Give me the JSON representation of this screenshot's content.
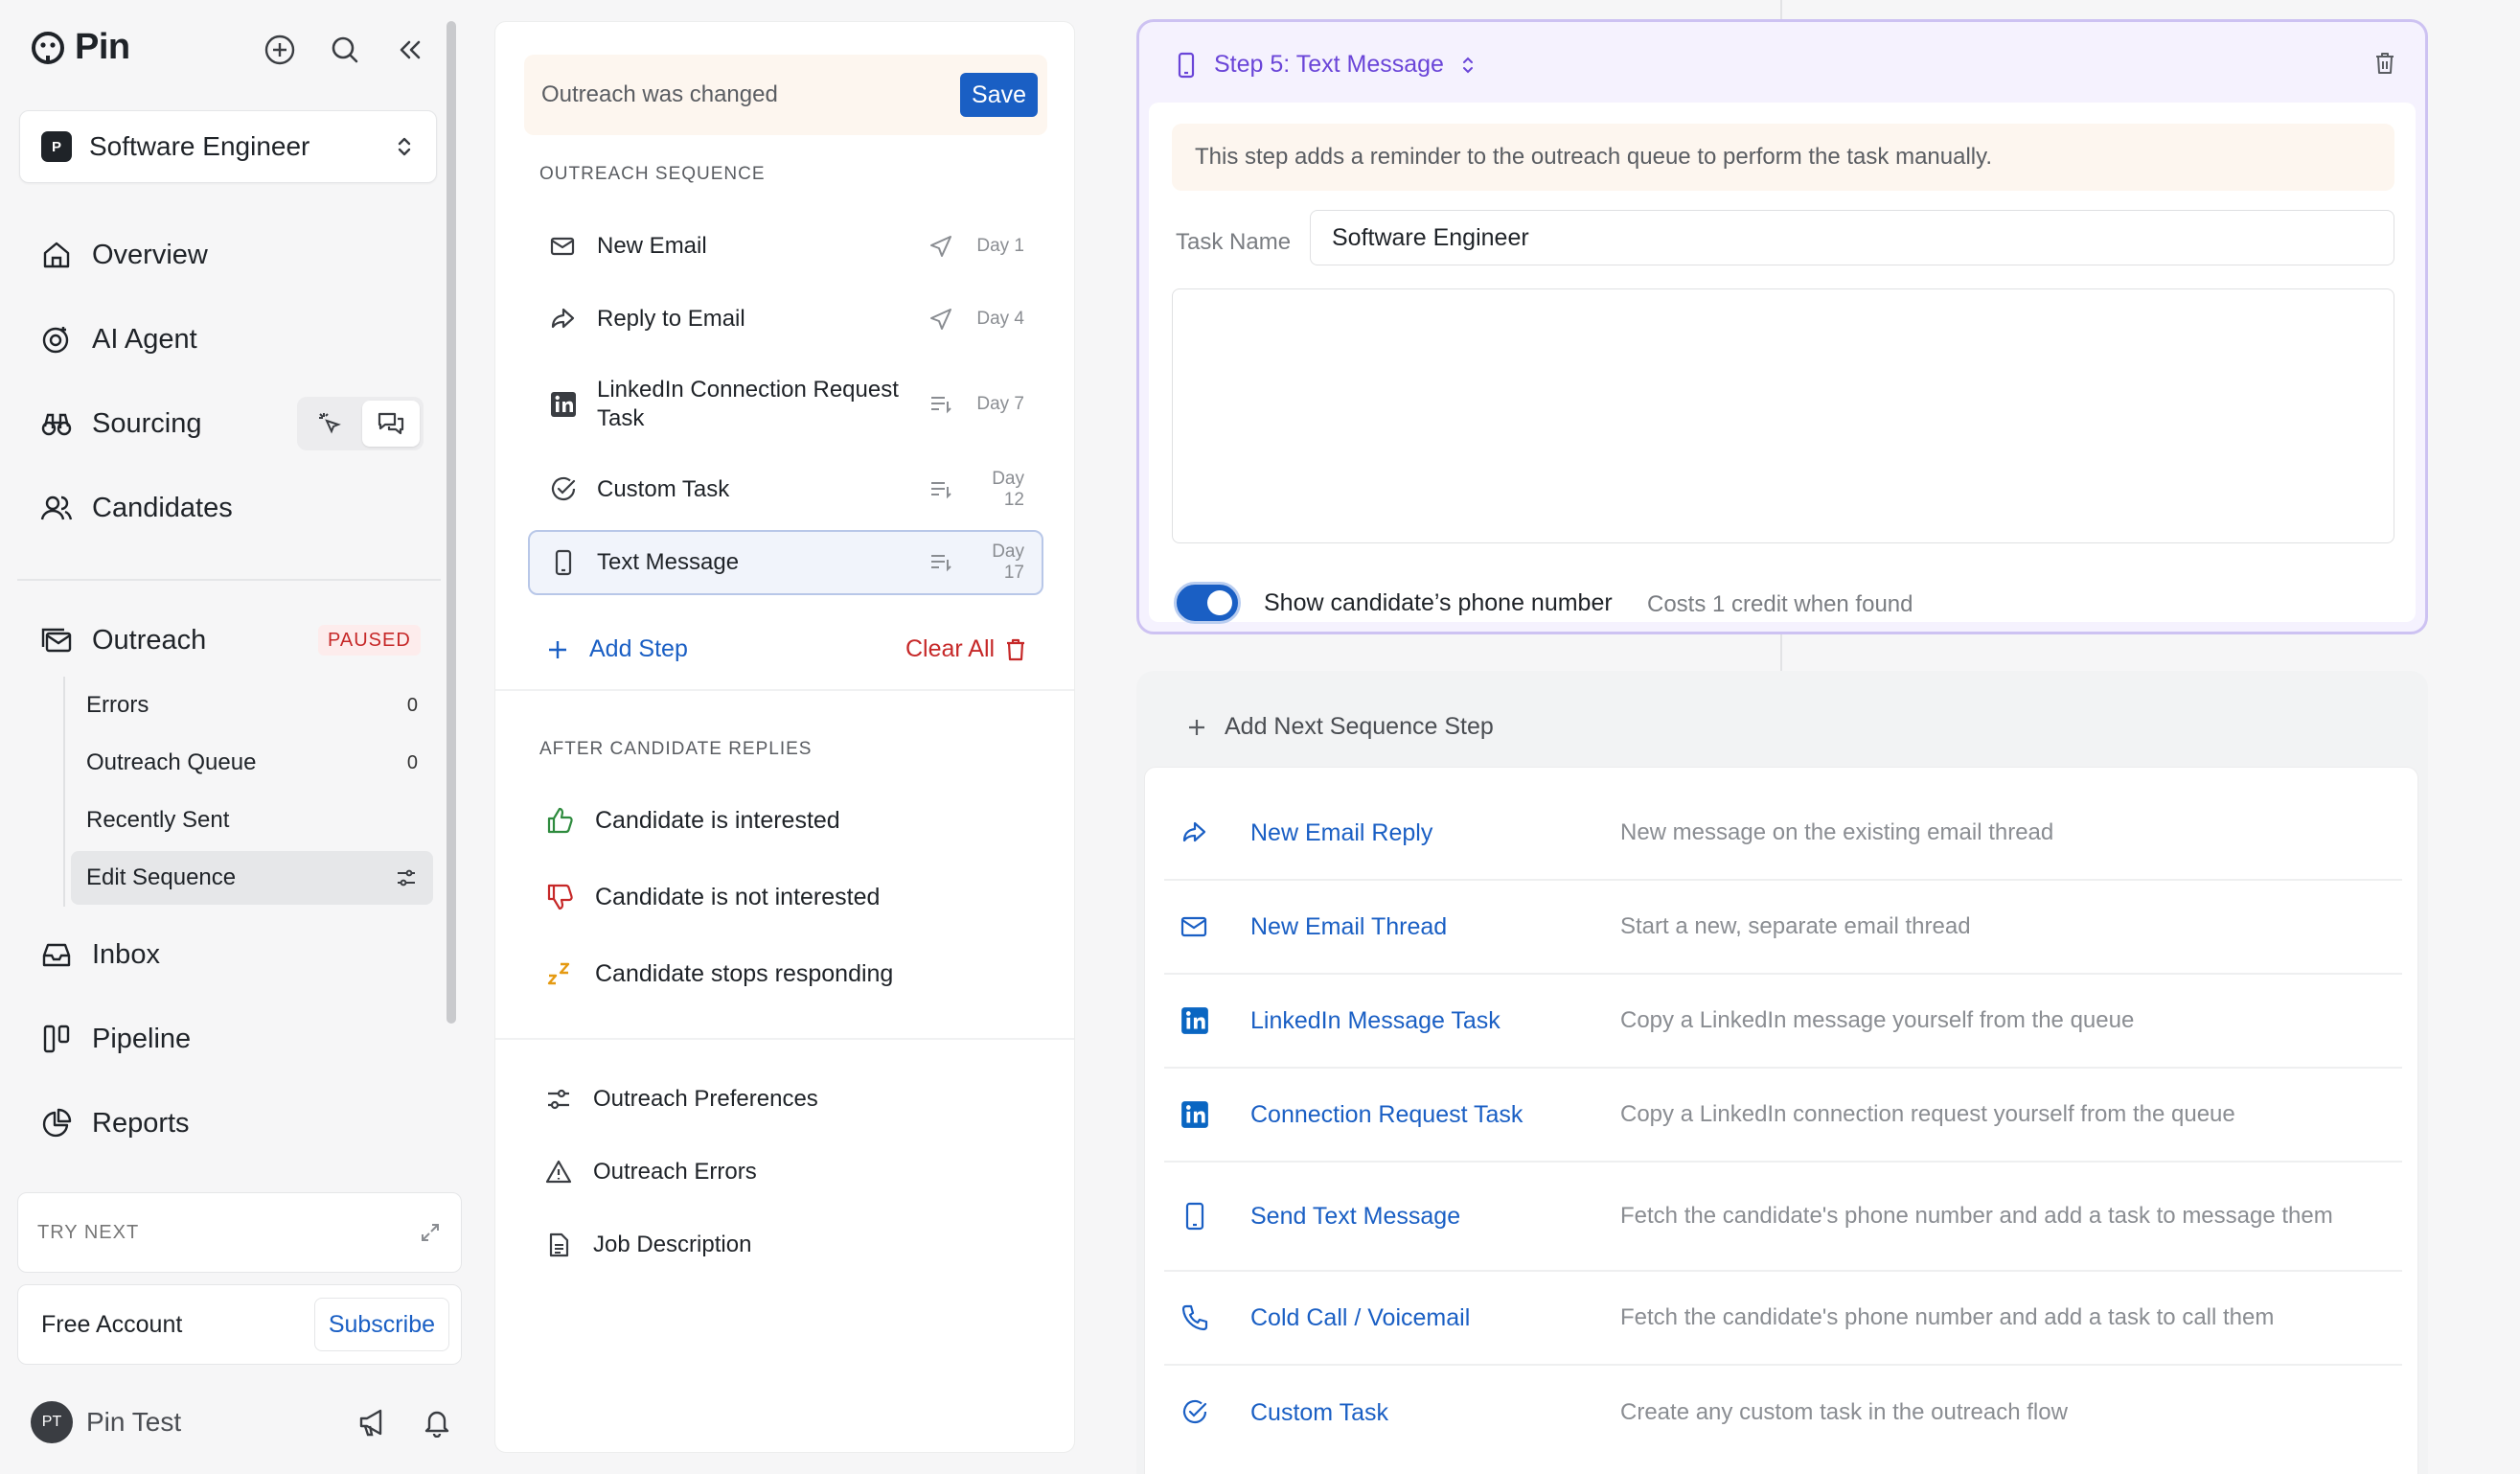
{
  "app": {
    "name": "Pin"
  },
  "project": {
    "badge": "P",
    "name": "Software Engineer"
  },
  "nav": {
    "overview": "Overview",
    "ai_agent": "AI Agent",
    "sourcing": "Sourcing",
    "candidates": "Candidates",
    "outreach": "Outreach",
    "outreach_status": "PAUSED",
    "inbox": "Inbox",
    "pipeline": "Pipeline",
    "reports": "Reports"
  },
  "outreach_sub": [
    {
      "label": "Errors",
      "count": "0"
    },
    {
      "label": "Outreach Queue",
      "count": "0"
    },
    {
      "label": "Recently Sent",
      "count": ""
    },
    {
      "label": "Edit Sequence",
      "count": ""
    }
  ],
  "try_next": {
    "label": "TRY NEXT"
  },
  "account": {
    "label": "Free Account",
    "subscribe": "Subscribe"
  },
  "user": {
    "initials": "PT",
    "name": "Pin Test"
  },
  "middle": {
    "changed_text": "Outreach was changed",
    "save_label": "Save",
    "sequence_title": "OUTREACH SEQUENCE",
    "steps": [
      {
        "label": "New Email",
        "day": "Day 1"
      },
      {
        "label": "Reply to Email",
        "day": "Day 4"
      },
      {
        "label": "LinkedIn Connection Request Task",
        "day": "Day 7"
      },
      {
        "label": "Custom Task",
        "day": "Day 12"
      },
      {
        "label": "Text Message",
        "day": "Day 17"
      }
    ],
    "add_step": "Add Step",
    "clear_all": "Clear All",
    "after_title": "AFTER CANDIDATE REPLIES",
    "replies": [
      {
        "label": "Candidate is interested"
      },
      {
        "label": "Candidate is not interested"
      },
      {
        "label": "Candidate stops responding"
      }
    ],
    "prefs": [
      {
        "label": "Outreach Preferences"
      },
      {
        "label": "Outreach Errors"
      },
      {
        "label": "Job Description"
      }
    ]
  },
  "step_card": {
    "title": "Step 5: Text Message",
    "info": "This step adds a reminder to the outreach queue to perform the task manually.",
    "task_name_label": "Task Name",
    "task_name_value": "Software Engineer",
    "toggle_label": "Show candidate’s phone number",
    "toggle_sub": "Costs 1 credit when found"
  },
  "next_step": {
    "header": "Add Next Sequence Step",
    "options": [
      {
        "name": "New Email Reply",
        "desc": "New message on the existing email thread"
      },
      {
        "name": "New Email Thread",
        "desc": "Start a new, separate email thread"
      },
      {
        "name": "LinkedIn Message Task",
        "desc": "Copy a LinkedIn message yourself from the queue"
      },
      {
        "name": "Connection Request Task",
        "desc": "Copy a LinkedIn connection request yourself from the queue"
      },
      {
        "name": "Send Text Message",
        "desc": "Fetch the candidate's phone number and add a task to message them"
      },
      {
        "name": "Cold Call / Voicemail",
        "desc": "Fetch the candidate's phone number and add a task to call them"
      },
      {
        "name": "Custom Task",
        "desc": "Create any custom task in the outreach flow"
      }
    ]
  },
  "colors": {
    "accent": "#1a5fc4",
    "purple": "#6a45d8",
    "danger": "#c62828",
    "linkedin": "#0a66c2"
  }
}
